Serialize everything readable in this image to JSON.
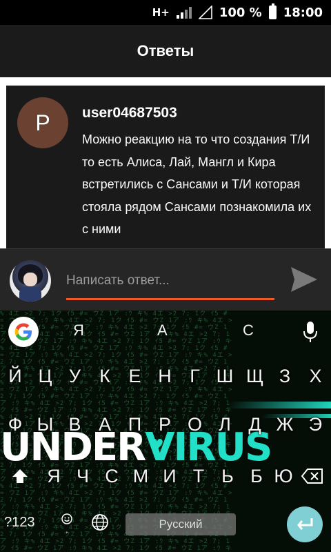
{
  "status_bar": {
    "network": "H+",
    "battery_percent": "100 %",
    "time": "18:00"
  },
  "app_bar": {
    "title": "Ответы"
  },
  "answer": {
    "avatar_letter": "P",
    "username": "user04687503",
    "text": "Можно реакцию на то что создания Т/И  то есть Алиса, Лай, Мангл и Кира встретились с Сансами и Т/И которая стояла рядом Сансами познакомила их с ними"
  },
  "reply": {
    "placeholder": "Написать ответ..."
  },
  "keyboard": {
    "suggestions": [
      "Я",
      "А",
      "С"
    ],
    "row1": [
      "Й",
      "Ц",
      "У",
      "К",
      "Е",
      "Н",
      "Г",
      "Ш",
      "Щ",
      "З",
      "Х"
    ],
    "row2": [
      "Ф",
      "Ы",
      "В",
      "А",
      "П",
      "Р",
      "О",
      "Л",
      "Д",
      "Ж",
      "Э"
    ],
    "row3": [
      "Я",
      "Ч",
      "С",
      "М",
      "И",
      "Т",
      "Ь",
      "Б",
      "Ю"
    ],
    "symbols_label": "?123",
    "space_label": "Русский",
    "theme_banner_left": "UNDER",
    "theme_banner_right": "VIRUS"
  },
  "colors": {
    "accent": "#f05a22",
    "banner_cyan": "#21e0c7",
    "enter_button": "#7fcfd4"
  },
  "icons": [
    "signal-bars-icon",
    "battery-icon",
    "send-icon",
    "google-icon",
    "mic-icon",
    "shift-icon",
    "backspace-icon",
    "emoji-icon",
    "globe-icon",
    "enter-icon"
  ]
}
